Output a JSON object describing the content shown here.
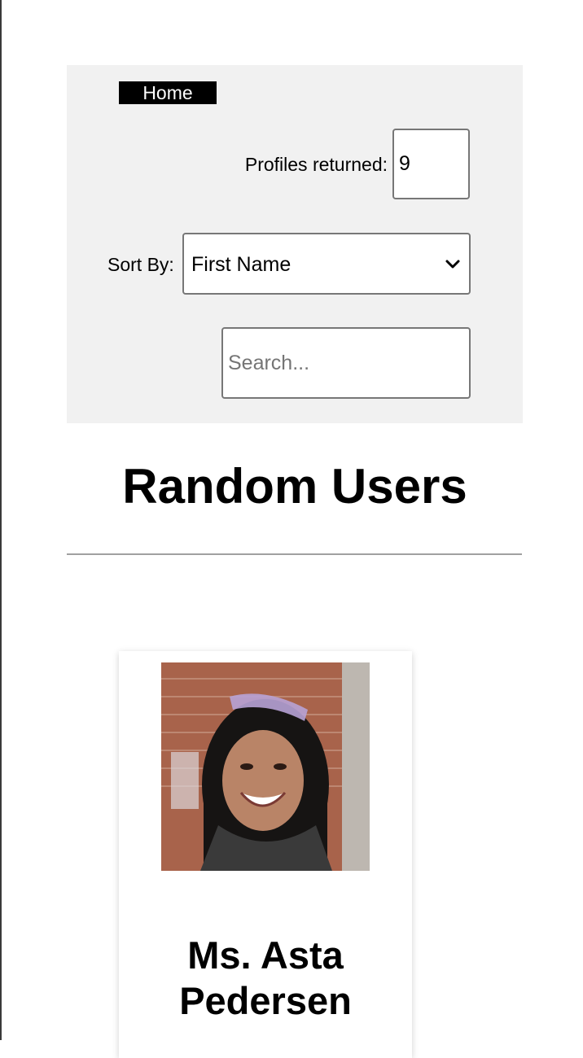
{
  "nav": {
    "home_label": "Home"
  },
  "controls": {
    "profiles_label": "Profiles returned:",
    "profiles_value": "9",
    "sort_label": "Sort By:",
    "sort_selected": "First Name",
    "search_placeholder": "Search..."
  },
  "main": {
    "title": "Random Users"
  },
  "users": [
    {
      "name": "Ms. Asta Pedersen"
    }
  ],
  "colors": {
    "panel_background": "#f1f1f1",
    "home_background": "#000000",
    "home_text": "#ffffff",
    "divider": "#a0a0a0"
  },
  "icons": {
    "select_arrow": "chevron-down-icon"
  }
}
